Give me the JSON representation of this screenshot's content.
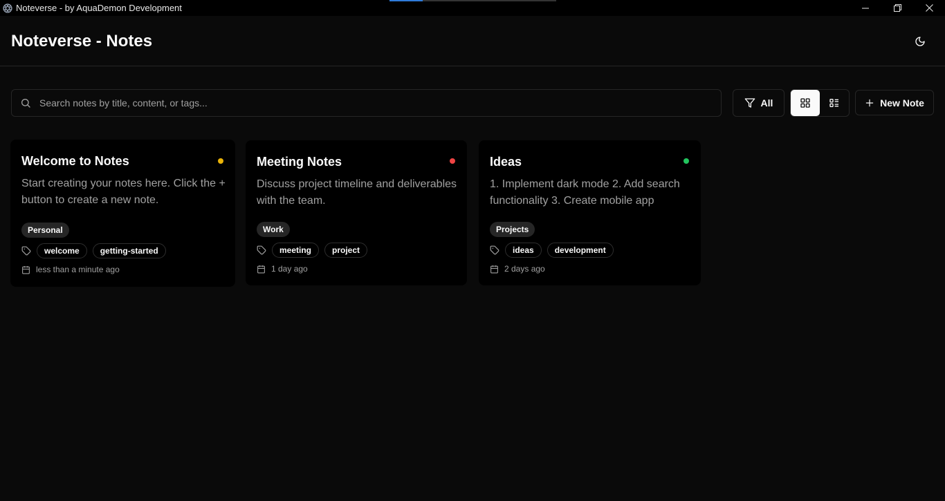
{
  "window": {
    "title": "Noteverse - by AquaDemon Development",
    "loading_progress": 0.2
  },
  "header": {
    "title": "Noteverse - Notes",
    "theme_icon": "moon-icon"
  },
  "toolbar": {
    "search_placeholder": "Search notes by title, content, or tags...",
    "filter_label": "All",
    "view_mode": "grid",
    "new_note_label": "New Note"
  },
  "notes": [
    {
      "title": "Welcome to Notes",
      "content": "Start creating your notes here. Click the + button to create a new note.",
      "priority_color": "#eab308",
      "category": "Personal",
      "tags": [
        "welcome",
        "getting-started"
      ],
      "date": "less than a minute ago"
    },
    {
      "title": "Meeting Notes",
      "content": "Discuss project timeline and deliverables with the team.",
      "priority_color": "#ef4444",
      "category": "Work",
      "tags": [
        "meeting",
        "project"
      ],
      "date": "1 day ago"
    },
    {
      "title": "Ideas",
      "content": "1. Implement dark mode 2. Add search functionality 3. Create mobile app",
      "priority_color": "#22c55e",
      "category": "Projects",
      "tags": [
        "ideas",
        "development"
      ],
      "date": "2 days ago"
    }
  ]
}
